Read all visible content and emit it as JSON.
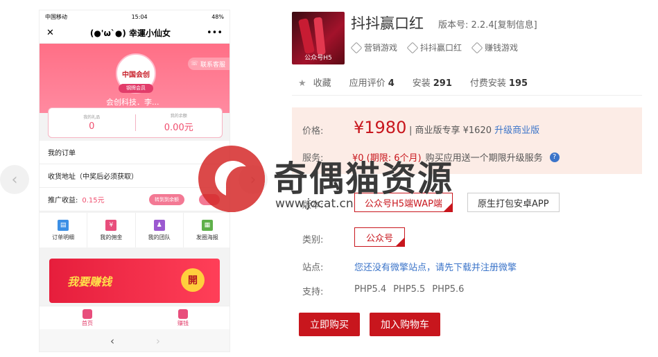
{
  "phone": {
    "status": {
      "carrier": "中国移动",
      "time": "15:04",
      "battery": "48%"
    },
    "nav": {
      "close": "✕",
      "title": "(●'ω`●) 幸運小仙女",
      "more": "•••"
    },
    "hero": {
      "avatar_text": "中国会创",
      "member_badge": "钢牌会员",
      "service_btn": "联系客服",
      "username": "会创科技．李..."
    },
    "stats": [
      {
        "label": "我的礼品",
        "value": "0"
      },
      {
        "label": "我的余额",
        "value": "0.00元"
      }
    ],
    "rows": {
      "orders": "我的订单",
      "address": "收货地址（中奖后必须获取）",
      "earn_label": "推广收益:",
      "earn_value": "0.15元",
      "transfer_btn": "转到到余额"
    },
    "grid": [
      {
        "label": "订单明细",
        "icon": "order-icon",
        "color": "#3b8fe5"
      },
      {
        "label": "我的佣金",
        "icon": "wallet-icon",
        "color": "#e84e7c"
      },
      {
        "label": "我的团队",
        "icon": "team-icon",
        "color": "#9b59d0"
      },
      {
        "label": "发圈海报",
        "icon": "qrcode-icon",
        "color": "#5fb04a"
      }
    ],
    "banner": {
      "text": "我要赚钱",
      "kai": "開"
    },
    "tabs": [
      {
        "label": "首页"
      },
      {
        "label": "赚钱"
      }
    ],
    "bottom": {
      "back": "‹",
      "forward": "›"
    }
  },
  "carousel": {
    "prev": "‹",
    "next": "›"
  },
  "app": {
    "thumb_caption": "公众号H5",
    "name": "抖抖赢口红",
    "version_label": "版本号: 2.2.4",
    "copy_info": "[复制信息]",
    "tags": [
      "营销游戏",
      "抖抖赢口红",
      "赚钱游戏"
    ],
    "favorite": "收藏",
    "rating_label": "应用评价",
    "rating": "4",
    "install_label": "安装",
    "installs": "291",
    "paid_label": "付费安装",
    "paid": "195"
  },
  "pricing": {
    "price_label": "价格:",
    "price": "¥1980",
    "biz_text": "| 商业版专享 ¥1620",
    "biz_link": "升级商业版",
    "service_label": "服务:",
    "service_value": "¥0 (期限: 6个月)",
    "service_note": "购买应用送一个期限升级服务",
    "help": "?"
  },
  "options": {
    "version_label": "版本:",
    "versions": [
      "公众号H5端WAP端",
      "原生打包安卓APP"
    ],
    "category_label": "类别:",
    "category": "公众号",
    "site_label": "站点:",
    "site_text": "您还没有微擎站点，请先下载并注册微擎",
    "support_label": "支持:",
    "php": [
      "PHP5.4",
      "PHP5.5",
      "PHP5.6"
    ]
  },
  "actions": {
    "buy": "立即购买",
    "cart": "加入购物车"
  },
  "watermark": {
    "title": "奇偶猫资源",
    "url": "www.jocat.cn"
  },
  "colors": {
    "accent": "#c8161d",
    "link": "#3b74c9",
    "pink": "#ff6f86"
  }
}
